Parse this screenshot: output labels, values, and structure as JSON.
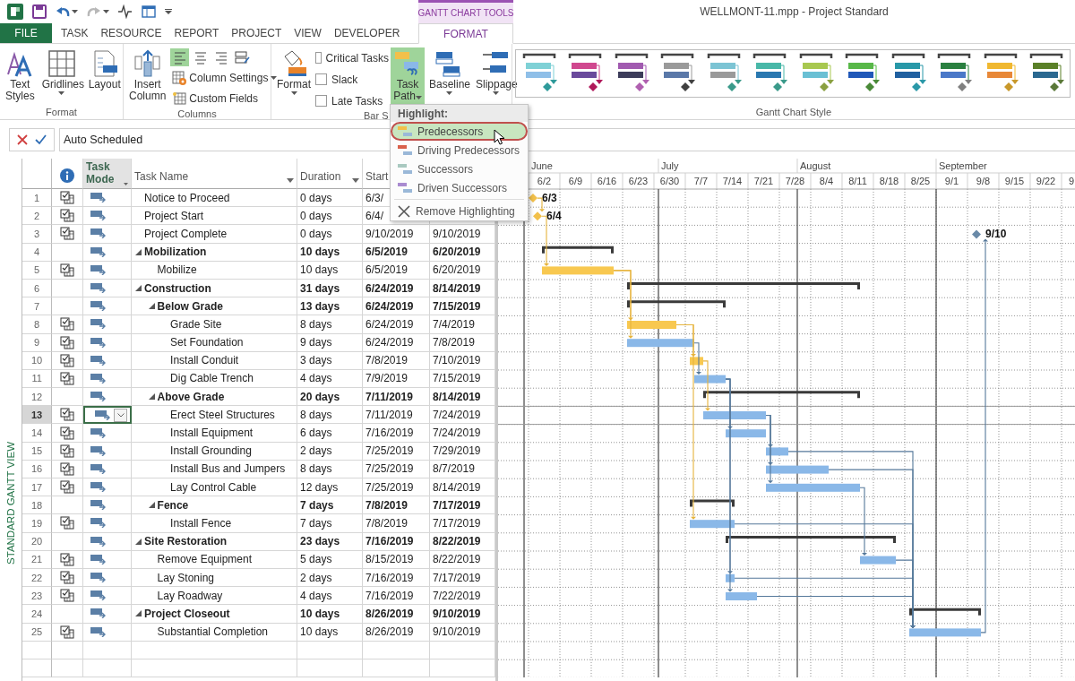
{
  "quick_access": [
    {
      "disabled": false
    },
    {
      "disabled": false
    },
    {
      "disabled": true
    },
    {
      "disabled": false
    },
    {
      "disabled": false
    }
  ],
  "context_tab_group": "GANTT CHART TOOLS",
  "window": {
    "title": "WELLMONT-11.mpp - Project Standard"
  },
  "tabs": [
    {
      "label": "FILE",
      "kind": "file",
      "selected": false
    },
    {
      "label": "TASK",
      "kind": "main",
      "selected": false
    },
    {
      "label": "RESOURCE",
      "kind": "main",
      "selected": false
    },
    {
      "label": "REPORT",
      "kind": "main",
      "selected": false
    },
    {
      "label": "PROJECT",
      "kind": "main",
      "selected": false
    },
    {
      "label": "VIEW",
      "kind": "main",
      "selected": false
    },
    {
      "label": "DEVELOPER",
      "kind": "main",
      "selected": false
    },
    {
      "label": "FORMAT",
      "kind": "context",
      "selected": true
    }
  ],
  "ribbon": {
    "groups": [
      {
        "label": "Format",
        "kind": "format",
        "buttons": [
          {
            "label": "Text Styles",
            "dropdown": false
          },
          {
            "label": "Gridlines",
            "dropdown": true
          },
          {
            "label": "Layout",
            "dropdown": false
          }
        ]
      },
      {
        "label": "Columns",
        "kind": "columns",
        "buttons": [
          {
            "label": "Insert Column",
            "dropdown": false
          }
        ],
        "align": [
          {
            "selected": true
          },
          {
            "selected": false
          },
          {
            "selected": false
          },
          {
            "selected": false
          }
        ],
        "small": [
          {
            "label": "Column Settings",
            "dropdown": true
          },
          {
            "label": "Custom Fields",
            "dropdown": false
          }
        ]
      },
      {
        "label": "Bar S",
        "kind": "bar-styles",
        "format": {
          "label": "Format",
          "dropdown": true
        },
        "checks": [
          {
            "label": "Critical Tasks",
            "checked": false
          },
          {
            "label": "Slack",
            "checked": false
          },
          {
            "label": "Late Tasks",
            "checked": false
          }
        ],
        "buttons": [
          {
            "label": "Task Path",
            "dropdown": true,
            "selected": true
          },
          {
            "label": "Baseline",
            "dropdown": true,
            "selected": false
          },
          {
            "label": "Slippage",
            "dropdown": true,
            "selected": false
          }
        ]
      },
      {
        "label": "Gantt Chart Style",
        "kind": "styles",
        "swatches": [
          {
            "bars": [
              {
                "color": "#7fd1d6"
              },
              {
                "color": "#8fbfe8"
              }
            ],
            "milestone": {
              "color": "#2e9a9a"
            }
          },
          {
            "bars": [
              {
                "color": "#d0488f"
              },
              {
                "color": "#6a4a9c"
              }
            ],
            "milestone": {
              "color": "#b0185a"
            }
          },
          {
            "bars": [
              {
                "color": "#a15ab0"
              },
              {
                "color": "#3c3c5a"
              }
            ],
            "milestone": {
              "color": "#b060b0"
            }
          },
          {
            "bars": [
              {
                "color": "#9a9a9a"
              },
              {
                "color": "#5a78a8"
              }
            ],
            "milestone": {
              "color": "#404040"
            }
          },
          {
            "bars": [
              {
                "color": "#7cc4d4"
              },
              {
                "color": "#9a9a9a"
              }
            ],
            "milestone": {
              "color": "#3a9a8a"
            }
          },
          {
            "bars": [
              {
                "color": "#48b8a8"
              },
              {
                "color": "#2a78b0"
              }
            ],
            "milestone": {
              "color": "#3a9a8a"
            }
          },
          {
            "bars": [
              {
                "color": "#a8c850"
              },
              {
                "color": "#6ac0d4"
              }
            ],
            "milestone": {
              "color": "#8aa040"
            }
          },
          {
            "bars": [
              {
                "color": "#58b848"
              },
              {
                "color": "#2058b8"
              }
            ],
            "milestone": {
              "color": "#4a8a38"
            }
          },
          {
            "bars": [
              {
                "color": "#2898a8"
              },
              {
                "color": "#2060a0"
              }
            ],
            "milestone": {
              "color": "#2a98a8"
            }
          },
          {
            "bars": [
              {
                "color": "#2a8040"
              },
              {
                "color": "#4a78c8"
              }
            ],
            "milestone": {
              "color": "#808080"
            }
          },
          {
            "bars": [
              {
                "color": "#f0b830"
              },
              {
                "color": "#e88838"
              }
            ],
            "milestone": {
              "color": "#c8982a"
            }
          },
          {
            "bars": [
              {
                "color": "#5a8028"
              },
              {
                "color": "#2a6890"
              }
            ],
            "milestone": {
              "color": "#5a7838"
            }
          }
        ]
      }
    ]
  },
  "task_path_menu": {
    "header": "Highlight:",
    "items": [
      {
        "label": "Predecessors",
        "kind": "highlight",
        "color": "#f2c04a",
        "selected": true
      },
      {
        "label": "Driving Predecessors",
        "kind": "highlight",
        "color": "#d9614c",
        "selected": false
      },
      {
        "label": "Successors",
        "kind": "highlight",
        "color": "#a9c9c0",
        "selected": false
      },
      {
        "label": "Driven Successors",
        "kind": "highlight",
        "color": "#a98bd0",
        "selected": false
      },
      {
        "label": "Remove Highlighting",
        "kind": "clear",
        "selected": false
      }
    ]
  },
  "entry_bar": {
    "value": "Auto Scheduled"
  },
  "side_label": "STANDARD GANTT VIEW",
  "table": {
    "columns": [
      {
        "kind": "row-number"
      },
      {
        "kind": "indicator"
      },
      {
        "kind": "text",
        "label": "Task Mode",
        "filter": true,
        "selected": true
      },
      {
        "kind": "text",
        "label": "Task Name",
        "filter": true,
        "selected": false
      },
      {
        "kind": "text",
        "label": "Duration",
        "filter": true,
        "selected": false
      },
      {
        "kind": "text",
        "label": "Start",
        "selected": false
      }
    ],
    "tasks": [
      {
        "id": "1",
        "name": "Notice to Proceed",
        "duration": "0 days",
        "start": "6/3/",
        "kind": "milestone",
        "label": "6/3",
        "indicator": true,
        "highlighted": true,
        "selected": false
      },
      {
        "id": "2",
        "name": "Project Start",
        "duration": "0 days",
        "start": "6/4/",
        "kind": "milestone",
        "label": "6/4",
        "indicator": true,
        "highlighted": true,
        "selected": false
      },
      {
        "id": "3",
        "name": "Project Complete",
        "duration": "0 days",
        "start": "9/10/2019",
        "finish": "9/10/2019",
        "kind": "milestone",
        "label": "9/10",
        "indicator": true,
        "highlighted": false,
        "selected": false
      },
      {
        "id": "4",
        "name": "Mobilization",
        "duration": "10 days",
        "start": "6/5/2019",
        "finish": "6/20/2019",
        "kind": "summary",
        "expanded": true,
        "indicator": false,
        "selected": false,
        "children": [
          {
            "id": "5",
            "name": "Mobilize",
            "duration": "10 days",
            "start": "6/5/2019",
            "finish": "6/20/2019",
            "kind": "task",
            "indicator": true,
            "highlighted": true,
            "selected": false
          }
        ]
      },
      {
        "id": "6",
        "name": "Construction",
        "duration": "31 days",
        "start": "6/24/2019",
        "finish": "8/14/2019",
        "kind": "summary",
        "expanded": true,
        "indicator": false,
        "selected": false,
        "children": [
          {
            "id": "7",
            "name": "Below Grade",
            "duration": "13 days",
            "start": "6/24/2019",
            "finish": "7/15/2019",
            "kind": "summary",
            "expanded": true,
            "indicator": false,
            "selected": false,
            "children": [
              {
                "id": "8",
                "name": "Grade Site",
                "duration": "8 days",
                "start": "6/24/2019",
                "finish": "7/4/2019",
                "kind": "task",
                "indicator": true,
                "highlighted": true,
                "selected": false
              },
              {
                "id": "9",
                "name": "Set Foundation",
                "duration": "9 days",
                "start": "6/24/2019",
                "finish": "7/8/2019",
                "kind": "task",
                "indicator": true,
                "highlighted": false,
                "selected": false
              },
              {
                "id": "10",
                "name": "Install Conduit",
                "duration": "3 days",
                "start": "7/8/2019",
                "finish": "7/10/2019",
                "kind": "task",
                "indicator": true,
                "highlighted": true,
                "selected": false
              },
              {
                "id": "11",
                "name": "Dig Cable Trench",
                "duration": "4 days",
                "start": "7/9/2019",
                "finish": "7/15/2019",
                "kind": "task",
                "indicator": true,
                "highlighted": false,
                "selected": false
              }
            ]
          },
          {
            "id": "12",
            "name": "Above Grade",
            "duration": "20 days",
            "start": "7/11/2019",
            "finish": "8/14/2019",
            "kind": "summary",
            "expanded": true,
            "indicator": false,
            "selected": false,
            "children": [
              {
                "id": "13",
                "name": "Erect Steel Structures",
                "duration": "8 days",
                "start": "7/11/2019",
                "finish": "7/24/2019",
                "kind": "task",
                "indicator": true,
                "highlighted": false,
                "selected": true
              },
              {
                "id": "14",
                "name": "Install Equipment",
                "duration": "6 days",
                "start": "7/16/2019",
                "finish": "7/24/2019",
                "kind": "task",
                "indicator": true,
                "highlighted": false,
                "selected": false
              },
              {
                "id": "15",
                "name": "Install Grounding",
                "duration": "2 days",
                "start": "7/25/2019",
                "finish": "7/29/2019",
                "kind": "task",
                "indicator": true,
                "highlighted": false,
                "selected": false
              },
              {
                "id": "16",
                "name": "Install Bus and Jumpers",
                "duration": "8 days",
                "start": "7/25/2019",
                "finish": "8/7/2019",
                "kind": "task",
                "indicator": true,
                "highlighted": false,
                "selected": false
              },
              {
                "id": "17",
                "name": "Lay Control Cable",
                "duration": "12 days",
                "start": "7/25/2019",
                "finish": "8/14/2019",
                "kind": "task",
                "indicator": true,
                "highlighted": false,
                "selected": false
              }
            ]
          },
          {
            "id": "18",
            "name": "Fence",
            "duration": "7 days",
            "start": "7/8/2019",
            "finish": "7/17/2019",
            "kind": "summary",
            "expanded": true,
            "indicator": false,
            "selected": false,
            "children": [
              {
                "id": "19",
                "name": "Install Fence",
                "duration": "7 days",
                "start": "7/8/2019",
                "finish": "7/17/2019",
                "kind": "task",
                "indicator": true,
                "highlighted": false,
                "selected": false
              }
            ]
          }
        ]
      },
      {
        "id": "20",
        "name": "Site Restoration",
        "duration": "23 days",
        "start": "7/16/2019",
        "finish": "8/22/2019",
        "kind": "summary",
        "expanded": true,
        "indicator": false,
        "selected": false,
        "children": [
          {
            "id": "21",
            "name": "Remove Equipment",
            "duration": "5 days",
            "start": "8/15/2019",
            "finish": "8/22/2019",
            "kind": "task",
            "indicator": true,
            "highlighted": false,
            "selected": false
          },
          {
            "id": "22",
            "name": "Lay Stoning",
            "duration": "2 days",
            "start": "7/16/2019",
            "finish": "7/17/2019",
            "kind": "task",
            "indicator": true,
            "highlighted": false,
            "selected": false
          },
          {
            "id": "23",
            "name": "Lay Roadway",
            "duration": "4 days",
            "start": "7/16/2019",
            "finish": "7/22/2019",
            "kind": "task",
            "indicator": true,
            "highlighted": false,
            "selected": false
          }
        ]
      },
      {
        "id": "24",
        "name": "Project Closeout",
        "duration": "10 days",
        "start": "8/26/2019",
        "finish": "9/10/2019",
        "kind": "summary",
        "expanded": true,
        "indicator": false,
        "selected": false,
        "children": [
          {
            "id": "25",
            "name": "Substantial Completion",
            "duration": "10 days",
            "start": "8/26/2019",
            "finish": "9/10/2019",
            "kind": "task",
            "indicator": true,
            "highlighted": false,
            "selected": false
          }
        ]
      }
    ]
  },
  "gantt": {
    "months": [
      "June",
      "July",
      "August",
      "September"
    ],
    "weeks": [
      "6/2",
      "6/9",
      "6/16",
      "6/23",
      "6/30",
      "7/7",
      "7/14",
      "7/21",
      "7/28",
      "8/4",
      "8/11",
      "8/18",
      "8/25",
      "9/1",
      "9/8",
      "9/15",
      "9/22",
      "9"
    ]
  }
}
